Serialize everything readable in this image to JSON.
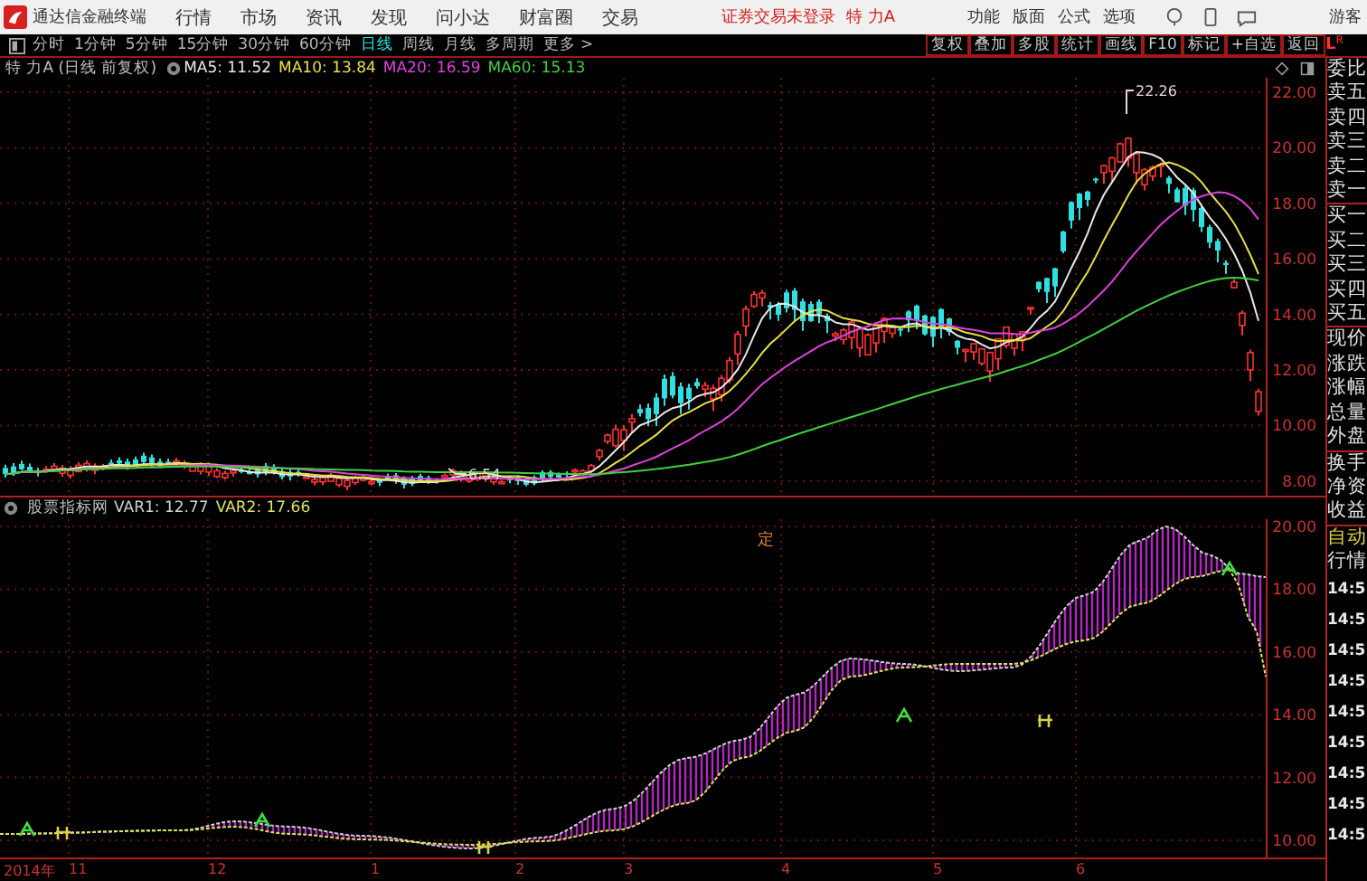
{
  "app": {
    "title": "通达信金融终端",
    "menu": [
      "行情",
      "市场",
      "资讯",
      "发现",
      "问小达",
      "财富圈",
      "交易"
    ],
    "login_status": "证券交易未登录",
    "stock_name": "特 力A",
    "right_menu": [
      "功能",
      "版面",
      "公式",
      "选项"
    ],
    "user": "游客"
  },
  "periods": [
    {
      "label": "分时",
      "selected": false
    },
    {
      "label": "1分钟",
      "selected": false
    },
    {
      "label": "5分钟",
      "selected": false
    },
    {
      "label": "15分钟",
      "selected": false
    },
    {
      "label": "30分钟",
      "selected": false
    },
    {
      "label": "60分钟",
      "selected": false
    },
    {
      "label": "日线",
      "selected": true
    },
    {
      "label": "周线",
      "selected": false
    },
    {
      "label": "月线",
      "selected": false
    },
    {
      "label": "多周期",
      "selected": false
    },
    {
      "label": "更多 >",
      "selected": false
    }
  ],
  "tools": [
    "复权",
    "叠加",
    "多股",
    "统计",
    "画线",
    "F10",
    "标记",
    "+自选",
    "返回"
  ],
  "main_chart": {
    "title": "特 力A (日线 前复权)",
    "ma": [
      {
        "label": "MA5: 11.52",
        "color": "#e8e8e8"
      },
      {
        "label": "MA10: 13.84",
        "color": "#e8e040"
      },
      {
        "label": "MA20: 16.59",
        "color": "#e040e0"
      },
      {
        "label": "MA60: 15.13",
        "color": "#40d040"
      }
    ],
    "yticks": [
      "22.00",
      "20.00",
      "18.00",
      "16.00",
      "14.00",
      "12.00",
      "10.00",
      "8.00"
    ],
    "high_label": "22.26",
    "low_label": "6.54"
  },
  "indicator": {
    "title": "股票指标网",
    "vars": [
      {
        "label": "VAR1: 12.77",
        "color": "#d0d0d0"
      },
      {
        "label": "VAR2: 17.66",
        "color": "#e0e060"
      }
    ],
    "marker": "定",
    "yticks": [
      "20.00",
      "18.00",
      "16.00",
      "14.00",
      "12.00",
      "10.00"
    ]
  },
  "date_axis": [
    "2014年",
    "11",
    "12",
    "1",
    "2",
    "3",
    "4",
    "5",
    "6"
  ],
  "side_panel": {
    "header": "L",
    "sub": "R",
    "order_book": [
      "委比",
      "卖五",
      "卖四",
      "卖三",
      "卖二",
      "卖一",
      "买一",
      "买二",
      "买三",
      "买四",
      "买五"
    ],
    "quote": [
      "现价",
      "涨跌",
      "涨幅",
      "总量",
      "外盘"
    ],
    "stats": [
      "换手",
      "净资",
      "收益"
    ],
    "auto": "自动",
    "ticks_title": "行情",
    "times": [
      "14:5",
      "14:5",
      "14:5",
      "14:5",
      "14:5",
      "14:5",
      "14:5",
      "14:5",
      "14:5"
    ]
  }
}
